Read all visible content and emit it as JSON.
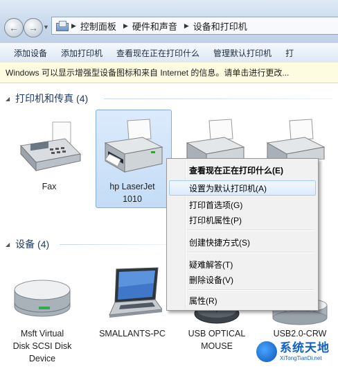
{
  "address_bar": {
    "breadcrumbs": [
      "控制面板",
      "硬件和声音",
      "设备和打印机"
    ]
  },
  "toolbar": {
    "items": [
      "添加设备",
      "添加打印机",
      "查看现在正在打印什么",
      "管理默认打印机",
      "打"
    ]
  },
  "info_bar": {
    "text": "Windows 可以显示增强型设备图标和来自 Internet 的信息。请单击进行更改..."
  },
  "groups": {
    "printers": {
      "title": "打印机和传真 (4)",
      "devices": [
        {
          "line1": "Fax",
          "line2": ""
        },
        {
          "line1": "hp LaserJet",
          "line2": "1010"
        }
      ]
    },
    "devices": {
      "title": "设备 (4)",
      "devices": [
        {
          "line1": "Msft Virtual",
          "line2": "Disk SCSI Disk",
          "line3": "Device"
        },
        {
          "line1": "SMALLANTS-PC"
        },
        {
          "line1": "USB OPTICAL",
          "line2": "MOUSE"
        },
        {
          "line1": "USB2.0-CRW"
        }
      ]
    }
  },
  "context_menu": {
    "items": [
      "查看现在正在打印什么(E)",
      "设置为默认打印机(A)",
      "打印首选项(G)",
      "打印机属性(P)",
      "创建快捷方式(S)",
      "疑难解答(T)",
      "删除设备(V)",
      "属性(R)"
    ],
    "highlighted_index": 1
  },
  "watermark": {
    "main": "系统天地",
    "sub": "XiTongTianDi.net"
  },
  "colors": {
    "group_header": "#1e3b6b",
    "selection": "#c4dcf6",
    "info_bar": "#fdfbe0",
    "watermark": "#1160c8"
  }
}
